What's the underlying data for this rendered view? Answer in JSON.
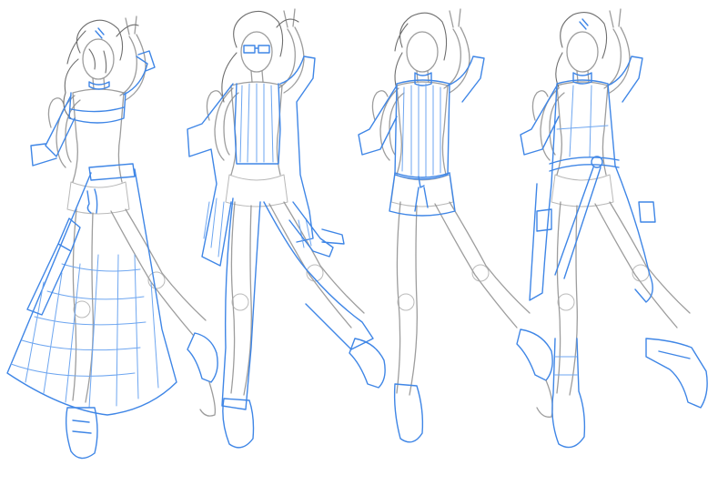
{
  "image": {
    "background": "#ffffff",
    "sketch_colors": {
      "construction": "#8c8c8c",
      "outfit_lines": "#3f86e6"
    },
    "figures": [
      {
        "id": "figure-1",
        "outfit": "long-skirt"
      },
      {
        "id": "figure-2",
        "outfit": "striped-jacket"
      },
      {
        "id": "figure-3",
        "outfit": "tunic-sweater"
      },
      {
        "id": "figure-4",
        "outfit": "wrap-coat"
      }
    ]
  }
}
